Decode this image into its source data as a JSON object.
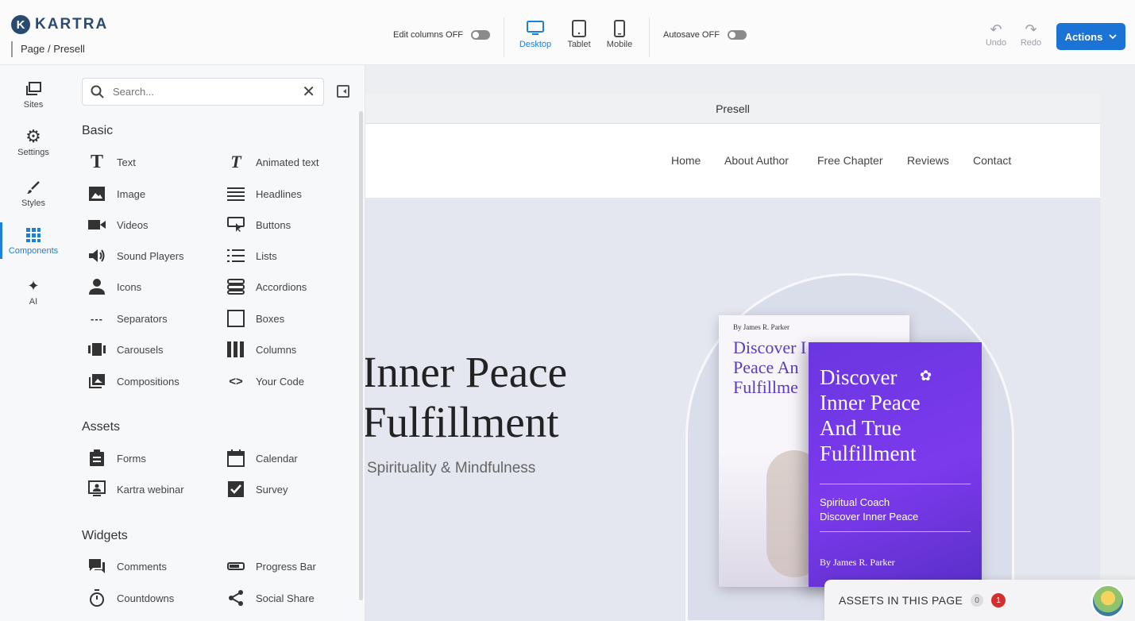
{
  "app": {
    "logo_mark": "K",
    "logo_text": "KARTRA",
    "breadcrumb": "Page / Presell"
  },
  "toolbar": {
    "edit_columns_label": "Edit columns OFF",
    "autosave_label": "Autosave OFF",
    "devices": [
      {
        "label": "Desktop",
        "icon": "desktop-icon",
        "active": true
      },
      {
        "label": "Tablet",
        "icon": "tablet-icon",
        "active": false
      },
      {
        "label": "Mobile",
        "icon": "mobile-icon",
        "active": false
      }
    ],
    "undo_label": "Undo",
    "redo_label": "Redo",
    "actions_label": "Actions"
  },
  "rail": {
    "items": [
      {
        "label": "Sites",
        "icon": "sites-icon"
      },
      {
        "label": "Settings",
        "icon": "gear-icon"
      },
      {
        "label": "Styles",
        "icon": "brush-icon"
      },
      {
        "label": "Components",
        "icon": "grid-icon",
        "active": true
      },
      {
        "label": "AI",
        "icon": "sparkle-icon"
      }
    ]
  },
  "panel": {
    "search_placeholder": "Search...",
    "sections": {
      "basic": "Basic",
      "assets": "Assets",
      "widgets": "Widgets"
    },
    "basic": [
      {
        "label": "Text",
        "icon": "text-icon"
      },
      {
        "label": "Animated text",
        "icon": "animated-text-icon"
      },
      {
        "label": "Image",
        "icon": "image-icon"
      },
      {
        "label": "Headlines",
        "icon": "headlines-icon"
      },
      {
        "label": "Videos",
        "icon": "video-icon"
      },
      {
        "label": "Buttons",
        "icon": "button-icon"
      },
      {
        "label": "Sound Players",
        "icon": "speaker-icon"
      },
      {
        "label": "Lists",
        "icon": "list-icon"
      },
      {
        "label": "Icons",
        "icon": "person-icon"
      },
      {
        "label": "Accordions",
        "icon": "accordion-icon"
      },
      {
        "label": "Separators",
        "icon": "separator-icon"
      },
      {
        "label": "Boxes",
        "icon": "box-icon"
      },
      {
        "label": "Carousels",
        "icon": "carousel-icon"
      },
      {
        "label": "Columns",
        "icon": "columns-icon"
      },
      {
        "label": "Compositions",
        "icon": "compositions-icon"
      },
      {
        "label": "Your Code",
        "icon": "code-icon"
      }
    ],
    "assets": [
      {
        "label": "Forms",
        "icon": "clipboard-icon"
      },
      {
        "label": "Calendar",
        "icon": "calendar-icon"
      },
      {
        "label": "Kartra webinar",
        "icon": "webinar-icon"
      },
      {
        "label": "Survey",
        "icon": "checkbox-icon"
      }
    ],
    "widgets": [
      {
        "label": "Comments",
        "icon": "comments-icon"
      },
      {
        "label": "Progress Bar",
        "icon": "progress-bar-icon"
      },
      {
        "label": "Countdowns",
        "icon": "stopwatch-icon"
      },
      {
        "label": "Social Share",
        "icon": "share-icon"
      }
    ]
  },
  "canvas": {
    "frame_title": "Presell",
    "nav_links": [
      "Home",
      "About Author",
      "Free Chapter",
      "Reviews",
      "Contact"
    ],
    "hero_title_line1": "Inner Peace",
    "hero_title_line2": "Fulfillment",
    "hero_subtitle": "Spirituality & Mindfulness",
    "book_back": {
      "by": "By James R. Parker",
      "title": "Discover I\nPeace An\nFulfillme"
    },
    "book_front": {
      "title": "Discover\nInner Peace\nAnd True\nFulfillment",
      "coach": "Spiritual Coach\nDiscover Inner Peace",
      "by": "By James R. Parker"
    }
  },
  "assets_bar": {
    "label": "ASSETS IN THIS PAGE",
    "count": "0",
    "alert_count": "1"
  },
  "colors": {
    "accent": "#1d7fd6",
    "actions_button": "#1b73d6",
    "book_purple": "#7c3aed",
    "alert_red": "#d32f2f"
  }
}
